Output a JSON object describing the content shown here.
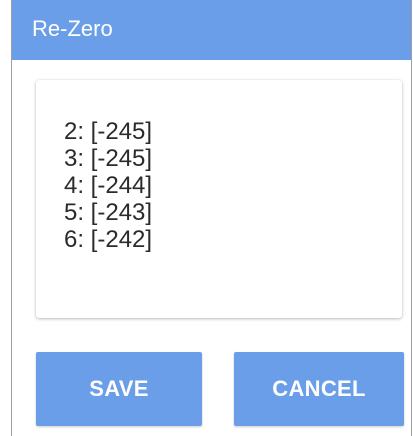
{
  "dialog": {
    "title": "Re-Zero",
    "lines": [
      "2: [-245]",
      "3: [-245]",
      "4: [-244]",
      "5: [-243]",
      "6: [-242]"
    ],
    "save_label": "SAVE",
    "cancel_label": "CANCEL"
  },
  "colors": {
    "accent": "#6b9ee9",
    "text": "#2b2b2b"
  }
}
